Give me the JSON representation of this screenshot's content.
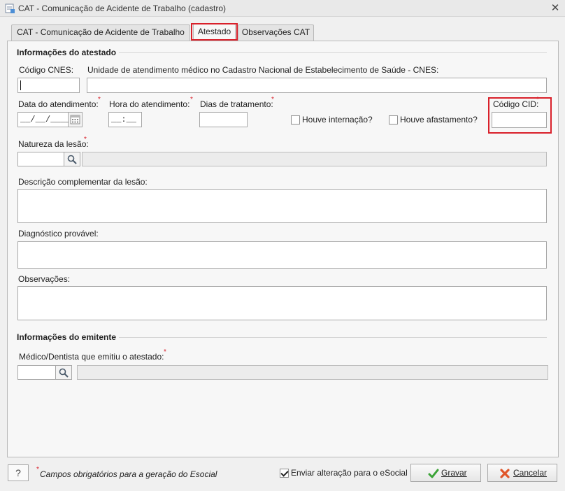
{
  "window": {
    "title": "CAT - Comunicação de Acidente de Trabalho (cadastro)",
    "close_symbol": "✕"
  },
  "tabs": [
    {
      "label": "CAT - Comunicação de Acidente de Trabalho",
      "active": false
    },
    {
      "label": "Atestado",
      "active": true
    },
    {
      "label": "Observações CAT",
      "active": false
    }
  ],
  "atestado": {
    "section_title": "Informações do atestado",
    "codigo_cnes_label": "Código CNES:",
    "codigo_cnes_value": "",
    "unidade_label": "Unidade de atendimento médico no Cadastro Nacional de Estabelecimento de Saúde - CNES:",
    "unidade_value": "",
    "data_label": "Data do atendimento:",
    "data_mask": "__/__/____",
    "hora_label": "Hora do atendimento:",
    "hora_mask": "__:__",
    "dias_label": "Dias de tratamento:",
    "dias_value": "",
    "internacao_label": "Houve internação?",
    "internacao_checked": false,
    "afastamento_label": "Houve afastamento?",
    "afastamento_checked": false,
    "cid_label": "Código CID:",
    "cid_value": "",
    "natureza_label": "Natureza da lesão:",
    "natureza_code": "",
    "natureza_desc": "",
    "descricao_label": "Descrição complementar da lesão:",
    "descricao_value": "",
    "diagnostico_label": "Diagnóstico provável:",
    "diagnostico_value": "",
    "observacoes_label": "Observações:",
    "observacoes_value": ""
  },
  "emitente": {
    "section_title": "Informações do emitente",
    "medico_label": "Médico/Dentista que emitiu o atestado:",
    "medico_code": "",
    "medico_desc": ""
  },
  "required_marker": "*",
  "footer": {
    "help_label": "?",
    "required_note": "Campos obrigatórios para a geração do Esocial",
    "send_label": "Enviar alteração para o eSocial",
    "send_checked": true,
    "save_label": "Gravar",
    "cancel_label": "Cancelar"
  },
  "colors": {
    "highlight": "#d9202a",
    "required": "#d9202a",
    "save_icon": "#3aa336",
    "cancel_icon": "#e0562a"
  }
}
